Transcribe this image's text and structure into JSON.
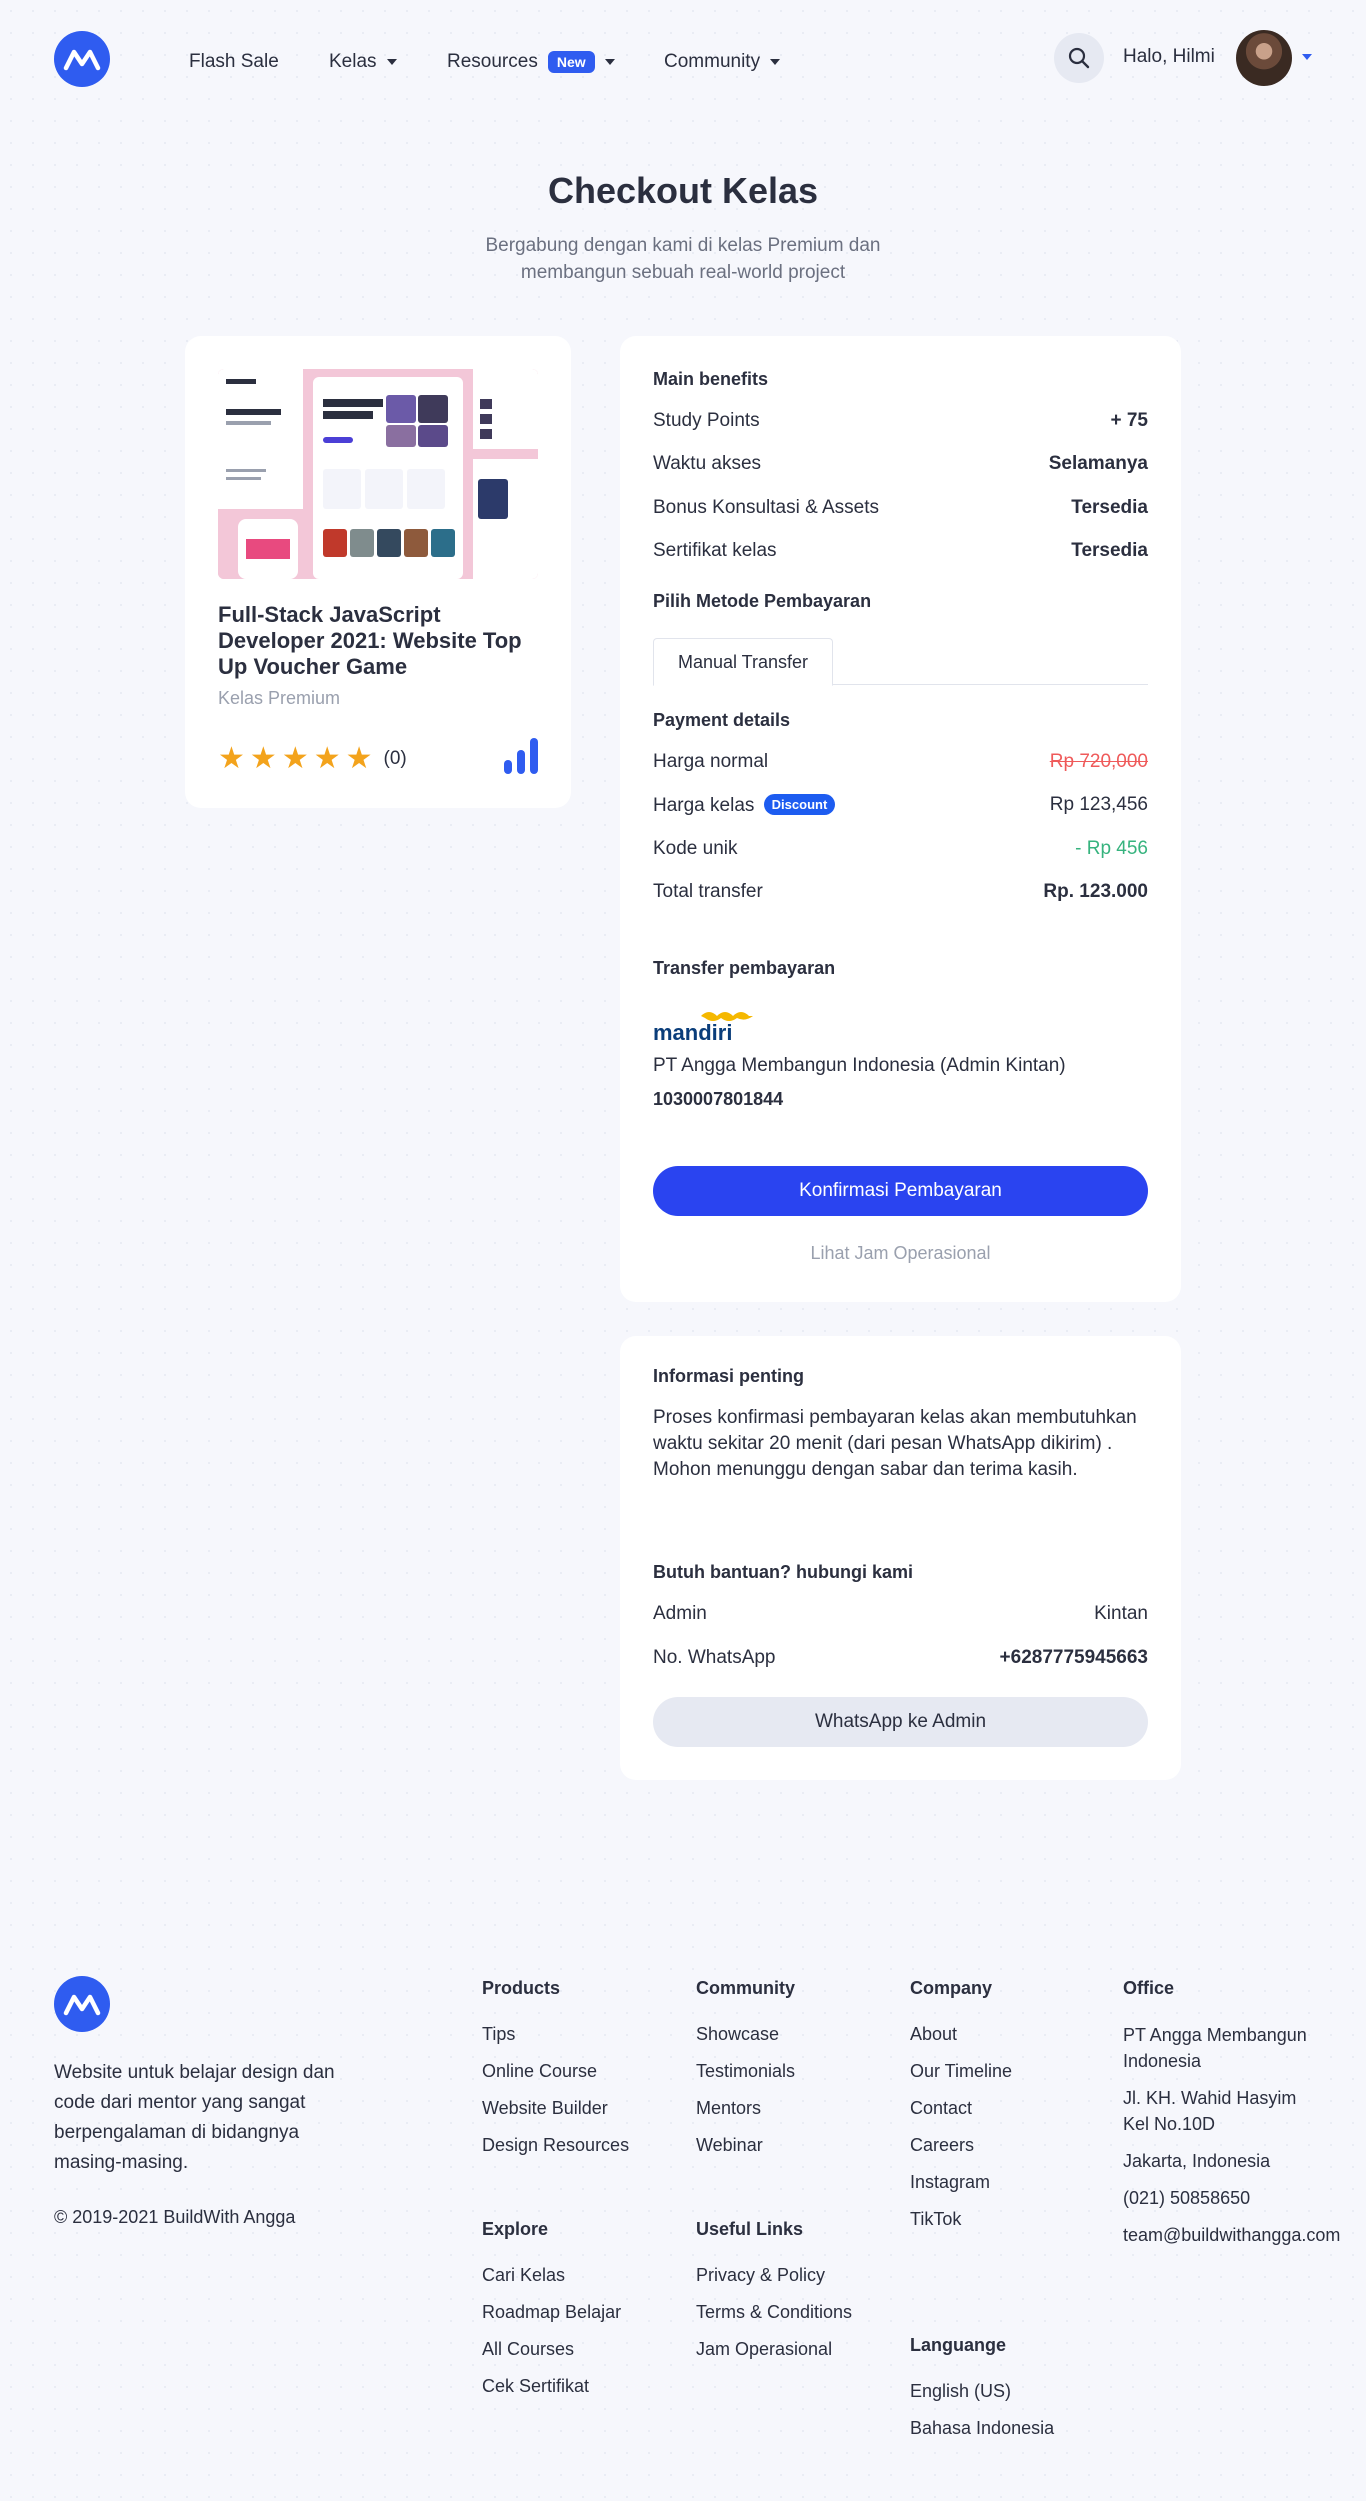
{
  "nav": {
    "items": [
      {
        "label": "Flash Sale"
      },
      {
        "label": "Kelas"
      },
      {
        "label": "Resources",
        "badge": "New"
      },
      {
        "label": "Community"
      }
    ],
    "greeting": "Halo, Hilmi"
  },
  "hero": {
    "title": "Checkout Kelas",
    "subtitle": "Bergabung dengan kami di kelas Premium dan membangun sebuah real-world project"
  },
  "course": {
    "title": "Full-Stack JavaScript Developer 2021: Website Top Up Voucher Game",
    "category": "Kelas Premium",
    "rating_count": "(0)",
    "stars": 5
  },
  "benefits": {
    "title": "Main benefits",
    "rows": [
      {
        "label": "Study Points",
        "value": "+ 75"
      },
      {
        "label": "Waktu akses",
        "value": "Selamanya"
      },
      {
        "label": "Bonus Konsultasi & Assets",
        "value": "Tersedia"
      },
      {
        "label": "Sertifikat kelas",
        "value": "Tersedia"
      }
    ]
  },
  "payment_method": {
    "title": "Pilih Metode Pembayaran",
    "tab": "Manual Transfer"
  },
  "payment_details": {
    "title": "Payment details",
    "harga_normal_label": "Harga normal",
    "harga_normal_value": "Rp 720,000",
    "harga_kelas_label": "Harga kelas",
    "discount_badge": "Discount",
    "harga_kelas_value": "Rp 123,456",
    "kode_unik_label": "Kode unik",
    "kode_unik_value": "- Rp 456",
    "total_label": "Total transfer",
    "total_value": "Rp. 123.000"
  },
  "transfer": {
    "title": "Transfer pembayaran",
    "bank_logo_text": "mandiri",
    "account_name": "PT Angga Membangun Indonesia (Admin Kintan)",
    "account_number": "1030007801844",
    "confirm_button": "Konfirmasi Pembayaran",
    "hours_link": "Lihat Jam Operasional"
  },
  "info": {
    "title": "Informasi penting",
    "text": "Proses konfirmasi pembayaran kelas akan membutuhkan waktu sekitar 20 menit (dari pesan WhatsApp dikirim) . Mohon menunggu dengan sabar dan terima kasih.",
    "help_title": "Butuh bantuan? hubungi kami",
    "admin_label": "Admin",
    "admin_value": "Kintan",
    "wa_label": "No. WhatsApp",
    "wa_value": "+6287775945663",
    "wa_button": "WhatsApp ke Admin"
  },
  "footer": {
    "description": "Website untuk belajar design dan code dari mentor yang sangat berpengalaman di bidangnya masing-masing.",
    "copyright": "© 2019-2021 BuildWith Angga",
    "products": {
      "title": "Products",
      "links": [
        "Tips",
        "Online Course",
        "Website Builder",
        "Design Resources"
      ]
    },
    "community": {
      "title": "Community",
      "links": [
        "Showcase",
        "Testimonials",
        "Mentors",
        "Webinar"
      ]
    },
    "company": {
      "title": "Company",
      "links": [
        "About",
        "Our Timeline",
        "Contact",
        "Careers",
        "Instagram",
        "TikTok"
      ]
    },
    "office": {
      "title": "Office",
      "lines": [
        "PT Angga Membangun Indonesia",
        "Jl. KH. Wahid Hasyim Kel No.10D",
        "Jakarta, Indonesia",
        "(021) 50858650",
        "team@buildwithangga.com"
      ]
    },
    "explore": {
      "title": "Explore",
      "links": [
        "Cari Kelas",
        "Roadmap Belajar",
        "All Courses",
        "Cek Sertifikat"
      ]
    },
    "useful": {
      "title": "Useful Links",
      "links": [
        "Privacy & Policy",
        "Terms & Conditions",
        "Jam Operasional"
      ]
    },
    "language": {
      "title": "Languange",
      "links": [
        "English (US)",
        "Bahasa Indonesia"
      ]
    }
  },
  "colors": {
    "primary": "#2a44f0",
    "star": "#f3a31c",
    "strike": "#ef5a5a",
    "green": "#36b37e"
  }
}
